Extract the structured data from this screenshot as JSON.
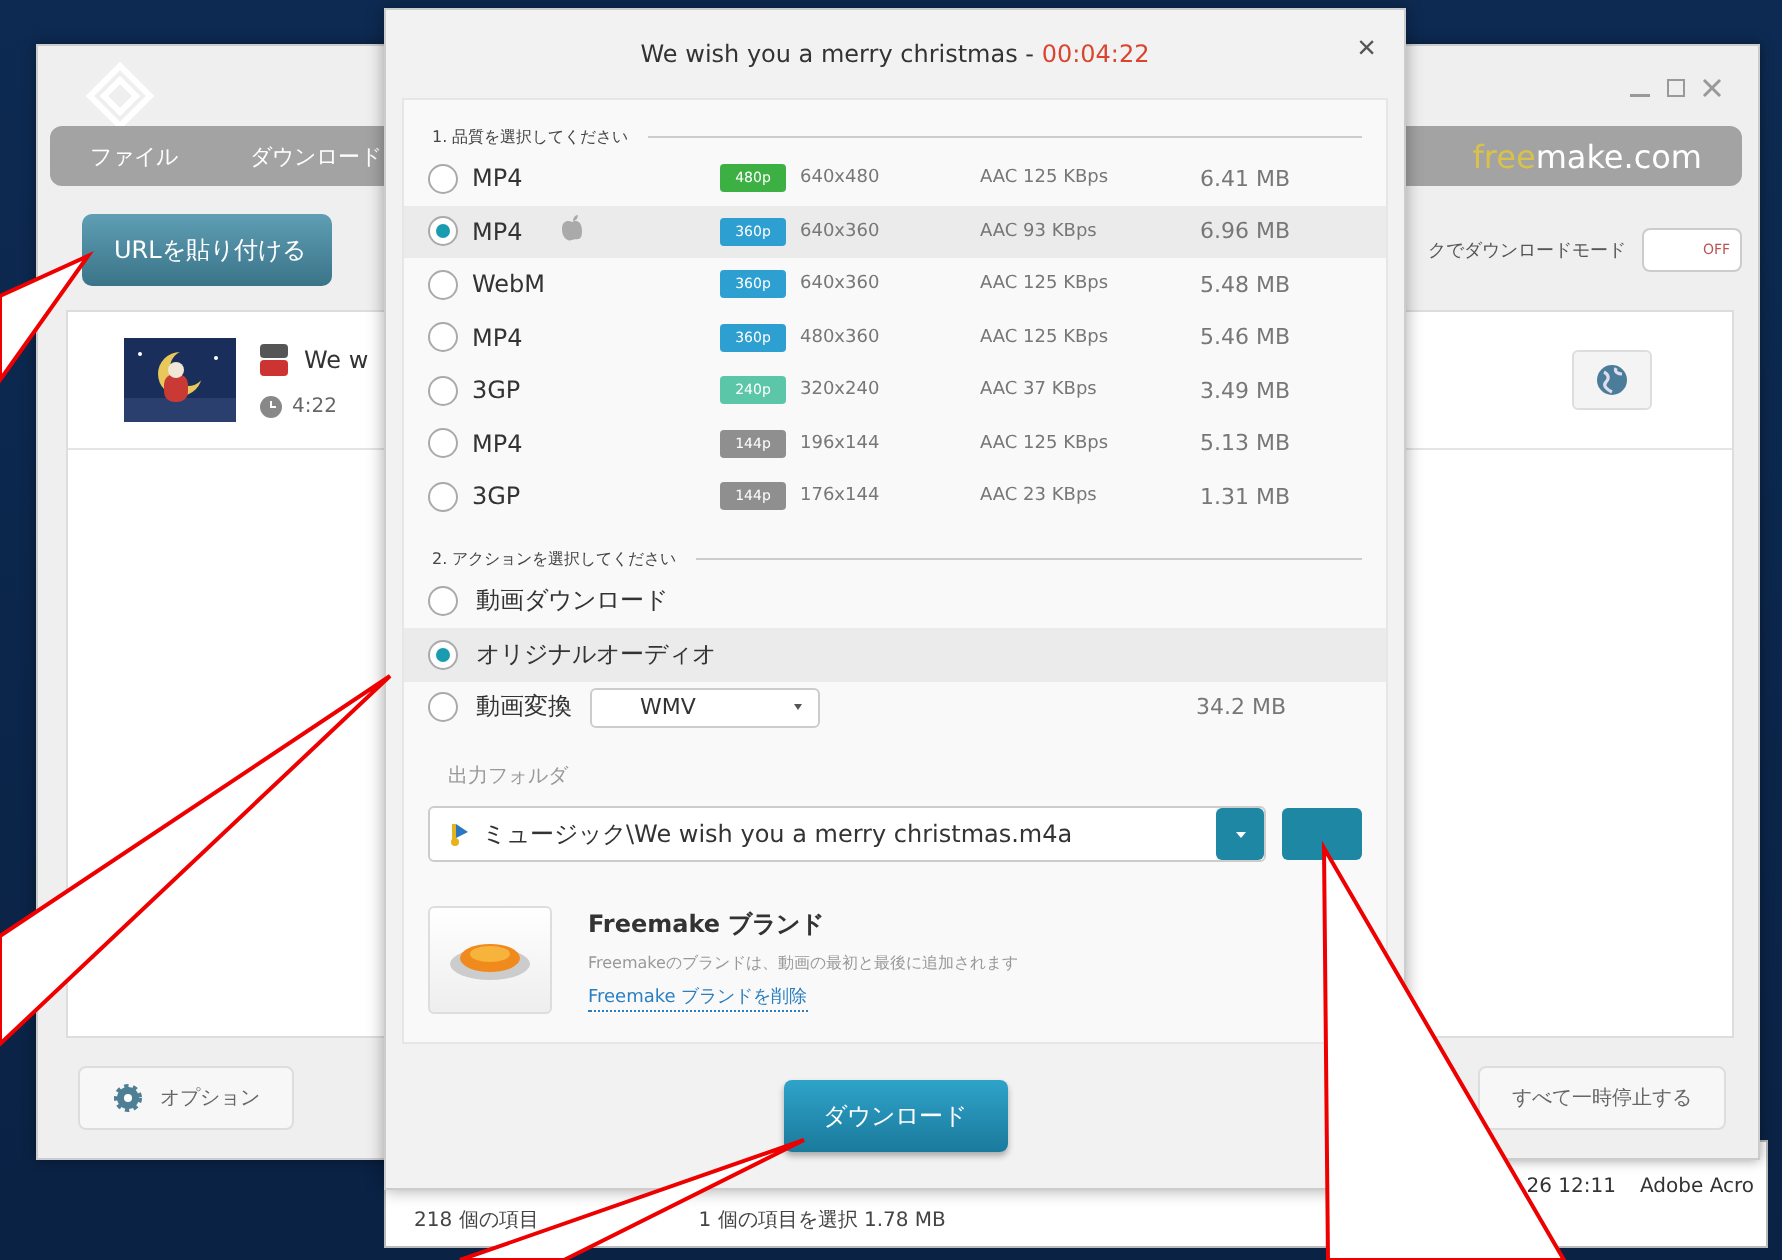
{
  "app_window": {
    "menu": [
      "ファイル",
      "ダウンロード"
    ],
    "site": {
      "lead": "free",
      "rest": "make.com"
    },
    "paste_button": "URLを貼り付ける",
    "mode_label": "クでダウンロードモード",
    "mode_toggle": {
      "label": "OFF",
      "on": false
    },
    "item": {
      "title": "We w",
      "duration": "4:22"
    },
    "footer": {
      "options": "オプション",
      "pause_all": "すべて一時停止する"
    }
  },
  "explorer": {
    "count": "218 個の項目",
    "selection": "1 個の項目を選択  1.78 MB",
    "date": "26 12:11",
    "app": "Adobe Acro"
  },
  "dialog": {
    "title": "We wish you a merry christmas - ",
    "time": "00:04:22",
    "close": "×",
    "quality_heading": "1. 品質を選択してください",
    "qualities": [
      {
        "format": "MP4",
        "apple": false,
        "badge": "480p",
        "color": "#3cb043",
        "resolution": "640x480",
        "audio": "AAC 125  KBps",
        "size": "6.41 MB",
        "selected": false
      },
      {
        "format": "MP4",
        "apple": true,
        "badge": "360p",
        "color": "#2d9fd0",
        "resolution": "640x360",
        "audio": "AAC 93  KBps",
        "size": "6.96 MB",
        "selected": true
      },
      {
        "format": "WebM",
        "apple": false,
        "badge": "360p",
        "color": "#2d9fd0",
        "resolution": "640x360",
        "audio": "AAC 125  KBps",
        "size": "5.48 MB",
        "selected": false
      },
      {
        "format": "MP4",
        "apple": false,
        "badge": "360p",
        "color": "#2d9fd0",
        "resolution": "480x360",
        "audio": "AAC 125  KBps",
        "size": "5.46 MB",
        "selected": false
      },
      {
        "format": "3GP",
        "apple": false,
        "badge": "240p",
        "color": "#5cc7a8",
        "resolution": "320x240",
        "audio": "AAC 37  KBps",
        "size": "3.49 MB",
        "selected": false
      },
      {
        "format": "MP4",
        "apple": false,
        "badge": "144p",
        "color": "#8f8f8f",
        "resolution": "196x144",
        "audio": "AAC 125  KBps",
        "size": "5.13 MB",
        "selected": false
      },
      {
        "format": "3GP",
        "apple": false,
        "badge": "144p",
        "color": "#8f8f8f",
        "resolution": "176x144",
        "audio": "AAC 23  KBps",
        "size": "1.31 MB",
        "selected": false
      }
    ],
    "action_heading": "2. アクションを選択してください",
    "actions": [
      {
        "kind": "plain",
        "label": "動画ダウンロード",
        "selected": false
      },
      {
        "kind": "plain",
        "label": "オリジナルオーディオ",
        "selected": true
      },
      {
        "kind": "convert",
        "label": "動画変換",
        "format": "WMV",
        "size": "34.2 MB",
        "selected": false
      }
    ],
    "folder_label": "出力フォルダ",
    "folder_path": "ミュージック\\We wish you a merry christmas.m4a",
    "brand": {
      "title": "Freemake ブランド",
      "description": "Freemakeのブランドは、動画の最初と最後に追加されます",
      "link": "Freemake ブランドを削除"
    },
    "download_button": "ダウンロード"
  }
}
